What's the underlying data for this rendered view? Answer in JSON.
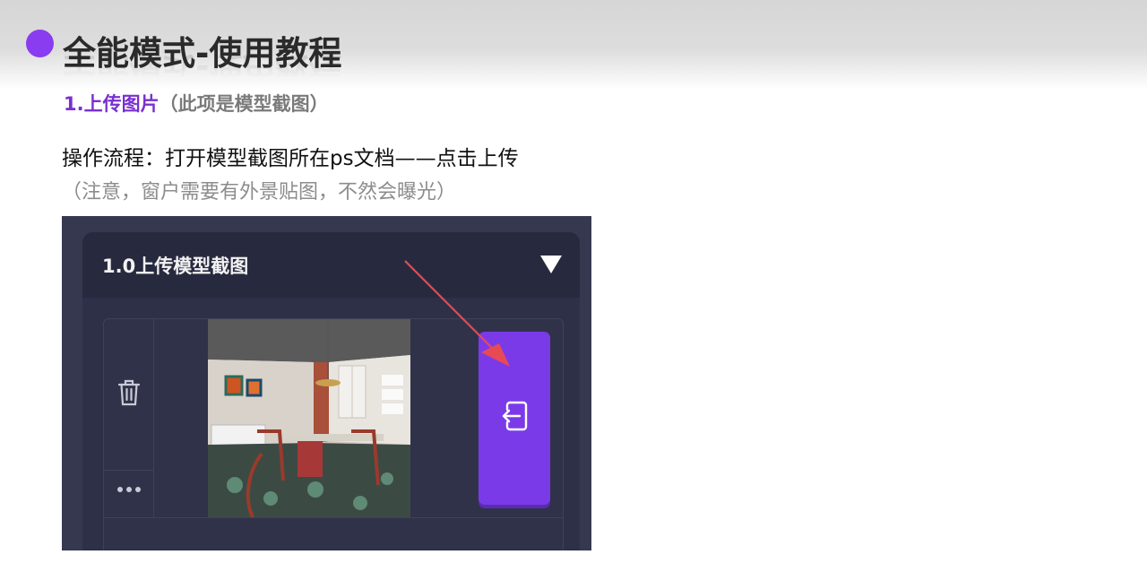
{
  "header": {
    "title": "全能模式-使用教程",
    "accent_color": "#8a3cf0"
  },
  "step": {
    "number_label": "1.上传图片",
    "note": "（此项是模型截图）"
  },
  "instructions": {
    "line1": "操作流程：打开模型截图所在ps文档——点击上传",
    "line2": "（注意，窗户需要有外景贴图，不然会曝光）"
  },
  "panel": {
    "title": "1.0上传模型截图",
    "collapse_icon": "triangle-down-icon",
    "delete_icon": "trash-icon",
    "more_icon": "more-dots-icon",
    "upload_icon": "import-icon",
    "upload_button_color": "#7b3ae8",
    "thumbnail": "dining-room-render"
  }
}
